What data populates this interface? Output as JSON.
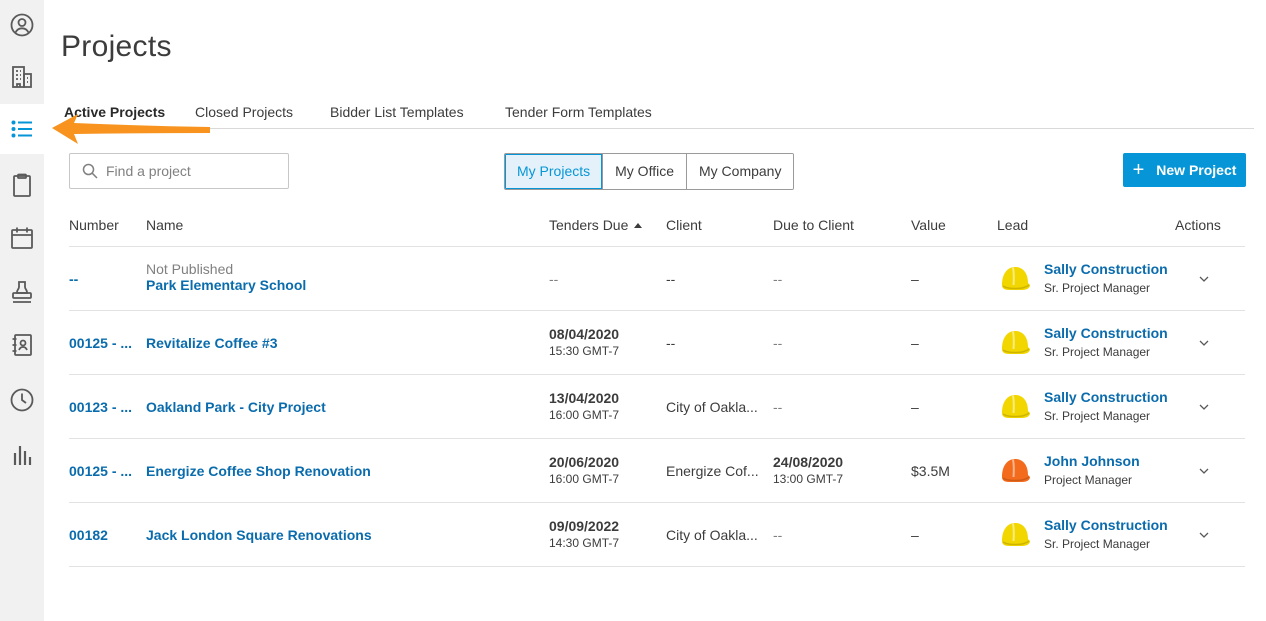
{
  "page_title": "Projects",
  "tabs": [
    {
      "label": "Active Projects",
      "active": true
    },
    {
      "label": "Closed Projects",
      "active": false
    },
    {
      "label": "Bidder List Templates",
      "active": false
    },
    {
      "label": "Tender Form Templates",
      "active": false
    }
  ],
  "search": {
    "placeholder": "Find a project",
    "value": ""
  },
  "scope_toggle": [
    {
      "label": "My Projects",
      "selected": true
    },
    {
      "label": "My Office",
      "selected": false
    },
    {
      "label": "My Company",
      "selected": false
    }
  ],
  "new_project_button": {
    "label": "New Project"
  },
  "rail_icons": [
    "user-circle-icon",
    "building-icon",
    "list-icon",
    "clipboard-icon",
    "calendar-icon",
    "stamp-icon",
    "address-book-icon",
    "clock-icon",
    "bar-chart-icon"
  ],
  "columns": {
    "number": "Number",
    "name": "Name",
    "tenders_due": "Tenders Due",
    "client": "Client",
    "due_to_client": "Due to Client",
    "value": "Value",
    "lead": "Lead",
    "actions": "Actions"
  },
  "rows": [
    {
      "number": "--",
      "status": "Not Published",
      "name": "Park Elementary School",
      "tenders_due_date": "--",
      "tenders_due_time": "",
      "client": "--",
      "due_to_client_date": "--",
      "due_to_client_time": "",
      "value": "–",
      "lead_name": "Sally Construction",
      "lead_role": "Sr. Project Manager",
      "lead_helmet_color": "#f2d600"
    },
    {
      "number": "00125 - ...",
      "status": "",
      "name": "Revitalize Coffee #3",
      "tenders_due_date": "08/04/2020",
      "tenders_due_time": "15:30 GMT-7",
      "client": "--",
      "due_to_client_date": "--",
      "due_to_client_time": "",
      "value": "–",
      "lead_name": "Sally Construction",
      "lead_role": "Sr. Project Manager",
      "lead_helmet_color": "#f2d600"
    },
    {
      "number": "00123 - ...",
      "status": "",
      "name": "Oakland Park - City Project",
      "tenders_due_date": "13/04/2020",
      "tenders_due_time": "16:00 GMT-7",
      "client": "City of Oakla...",
      "due_to_client_date": "--",
      "due_to_client_time": "",
      "value": "–",
      "lead_name": "Sally Construction",
      "lead_role": "Sr. Project Manager",
      "lead_helmet_color": "#f2d600"
    },
    {
      "number": "00125 - ...",
      "status": "",
      "name": "Energize Coffee Shop Renovation",
      "tenders_due_date": "20/06/2020",
      "tenders_due_time": "16:00 GMT-7",
      "client": "Energize Cof...",
      "due_to_client_date": "24/08/2020",
      "due_to_client_time": "13:00 GMT-7",
      "value": "$3.5M",
      "lead_name": "John Johnson",
      "lead_role": "Project Manager",
      "lead_helmet_color": "#f36b1c"
    },
    {
      "number": "00182",
      "status": "",
      "name": "Jack London Square Renovations",
      "tenders_due_date": "09/09/2022",
      "tenders_due_time": "14:30 GMT-7",
      "client": "City of Oakla...",
      "due_to_client_date": "--",
      "due_to_client_time": "",
      "value": "–",
      "lead_name": "Sally Construction",
      "lead_role": "Sr. Project Manager",
      "lead_helmet_color": "#f2d600"
    }
  ],
  "colors": {
    "accent": "#0696d7",
    "link": "#0a6cad",
    "annotation_arrow": "#f7931e"
  }
}
